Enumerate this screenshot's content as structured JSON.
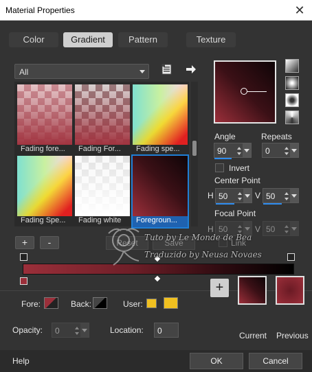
{
  "window": {
    "title": "Material Properties",
    "close_label": "✕"
  },
  "tabs": [
    "Color",
    "Gradient",
    "Pattern",
    "Texture"
  ],
  "library": {
    "dropdown_value": "All"
  },
  "gallery": {
    "items": [
      {
        "caption": "Fading fore..."
      },
      {
        "caption": "Fading For..."
      },
      {
        "caption": "Fading spe..."
      },
      {
        "caption": "Fading Spe..."
      },
      {
        "caption": "Fading white"
      },
      {
        "caption": "Foregroun..."
      }
    ]
  },
  "controls": {
    "add_label": "+",
    "remove_label": "-",
    "reset_label": "Reset",
    "save_label": "Save",
    "link_label": "Link"
  },
  "gradient": {
    "angle_label": "Angle",
    "angle_value": "90",
    "repeats_label": "Repeats",
    "repeats_value": "0",
    "invert_label": "Invert",
    "center_label": "Center Point",
    "center_h": "50",
    "center_v": "50",
    "focal_label": "Focal Point",
    "focal_h": "50",
    "focal_v": "50",
    "h_label": "H",
    "v_label": "V"
  },
  "stops": {
    "fore_label": "Fore:",
    "back_label": "Back:",
    "user_label": "User:",
    "opacity_label": "Opacity:",
    "opacity_value": "0",
    "location_label": "Location:",
    "location_value": "0",
    "user_color": "#f0c020"
  },
  "previews": {
    "current_label": "Current",
    "previous_label": "Previous"
  },
  "footer": {
    "help_label": "Help",
    "ok_label": "OK",
    "cancel_label": "Cancel"
  },
  "watermark": {
    "line1": "Tuto by Le Monde de Bea",
    "line2": "Traduzido by Neusa Novaes"
  },
  "colors": {
    "accent": "#1f7fd6",
    "gradient_start": "#9b2f3a",
    "gradient_end": "#000000"
  }
}
